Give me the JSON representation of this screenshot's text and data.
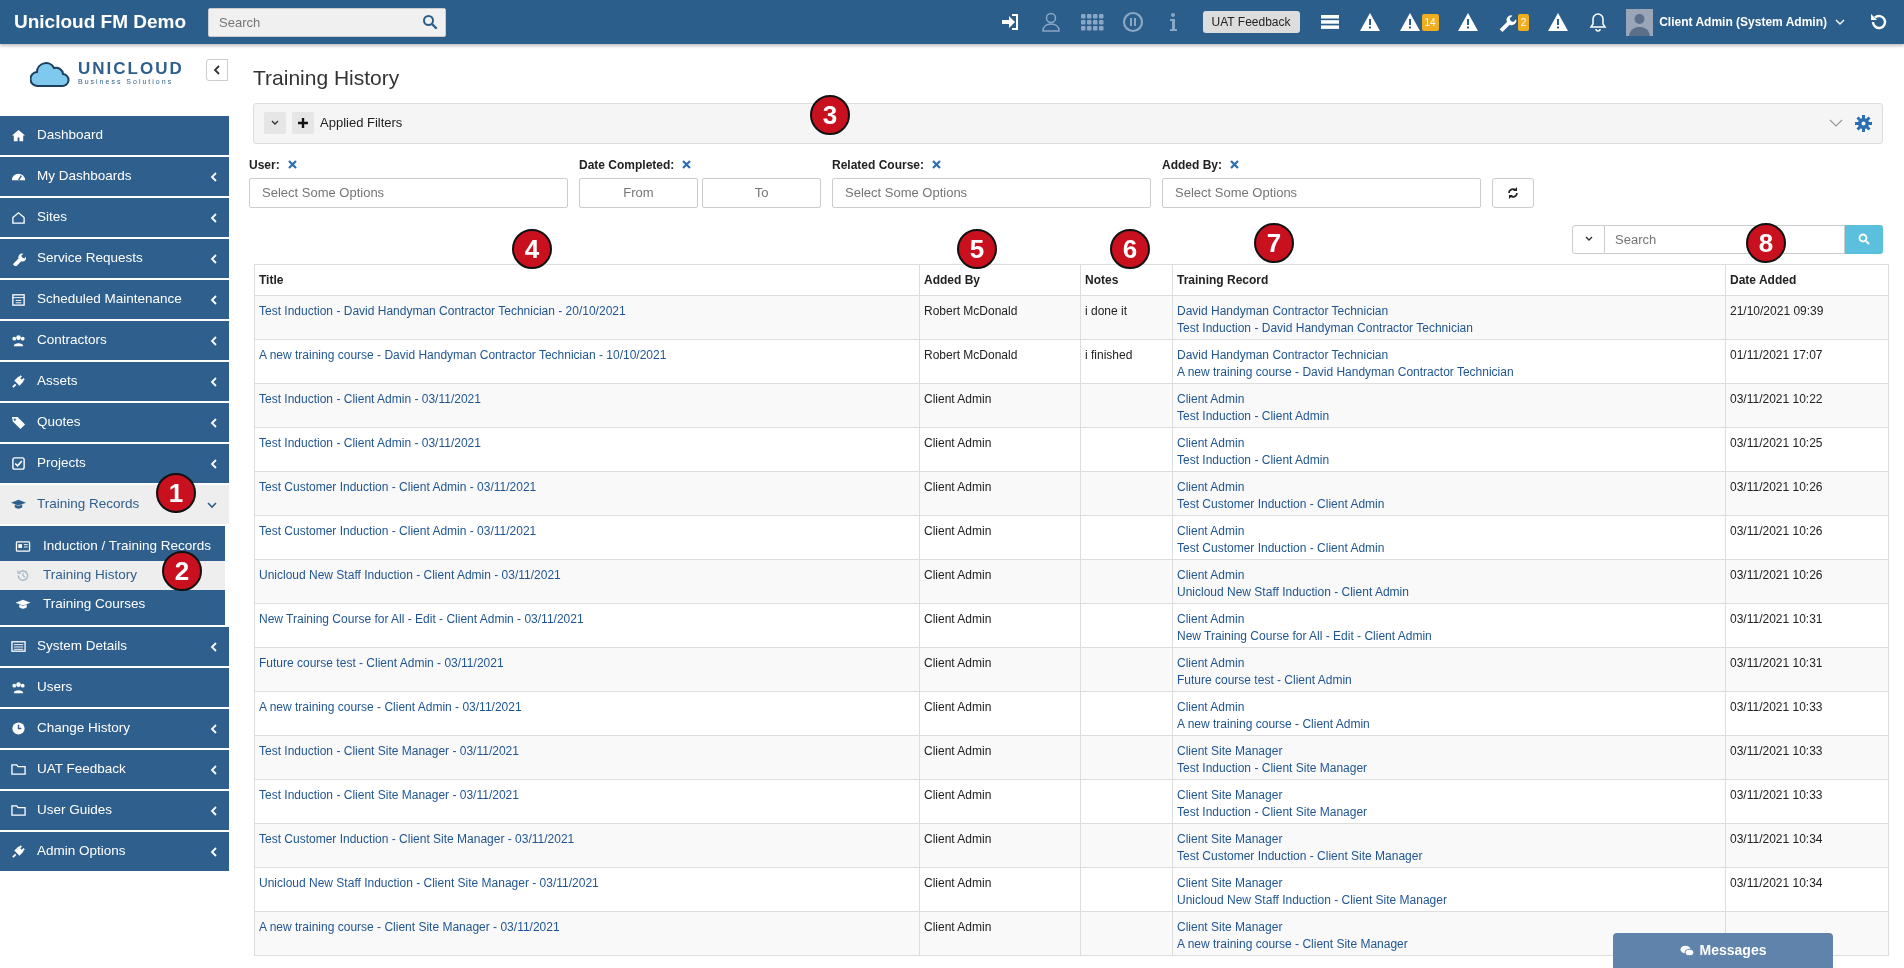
{
  "topbar": {
    "brand": "Unicloud FM Demo",
    "search": {
      "placeholder": "Search"
    },
    "feedback_button": "UAT Feedback",
    "alert_badge": "14",
    "tools_badge": "2",
    "user": "Client Admin (System Admin)"
  },
  "sidebar": {
    "logo": {
      "name": "UNICLOUD",
      "tagline": "Business Solutions"
    },
    "items": [
      {
        "label": "Dashboard",
        "kind": "link",
        "expanded": false,
        "selected": false
      },
      {
        "label": "My Dashboards",
        "kind": "menu",
        "expanded": false,
        "selected": false
      },
      {
        "label": "Sites",
        "kind": "menu",
        "expanded": false,
        "selected": false
      },
      {
        "label": "Service Requests",
        "kind": "menu",
        "expanded": false,
        "selected": false
      },
      {
        "label": "Scheduled Maintenance",
        "kind": "menu",
        "expanded": false,
        "selected": false
      },
      {
        "label": "Contractors",
        "kind": "menu",
        "expanded": false,
        "selected": false
      },
      {
        "label": "Assets",
        "kind": "menu",
        "expanded": false,
        "selected": false
      },
      {
        "label": "Quotes",
        "kind": "menu",
        "expanded": false,
        "selected": false
      },
      {
        "label": "Projects",
        "kind": "menu",
        "expanded": false,
        "selected": false
      },
      {
        "label": "Training Records",
        "kind": "menu",
        "expanded": true,
        "selected": true,
        "children": [
          {
            "label": "Induction / Training Records",
            "selected": false
          },
          {
            "label": "Training History",
            "selected": true
          },
          {
            "label": "Training Courses",
            "selected": false
          }
        ]
      },
      {
        "label": "System Details",
        "kind": "menu",
        "expanded": false,
        "selected": false
      },
      {
        "label": "Users",
        "kind": "link",
        "expanded": false,
        "selected": false
      },
      {
        "label": "Change History",
        "kind": "menu",
        "expanded": false,
        "selected": false
      },
      {
        "label": "UAT Feedback",
        "kind": "menu",
        "expanded": false,
        "selected": false
      },
      {
        "label": "User Guides",
        "kind": "menu",
        "expanded": false,
        "selected": false
      },
      {
        "label": "Admin Options",
        "kind": "menu",
        "expanded": false,
        "selected": false
      }
    ]
  },
  "page_title": "Training History",
  "filter_bar": {
    "label": "Applied Filters"
  },
  "filters": [
    {
      "label": "User:",
      "kind": "select",
      "placeholder": "Select Some Options"
    },
    {
      "label": "Date Completed:",
      "kind": "range",
      "from_placeholder": "From",
      "to_placeholder": "To"
    },
    {
      "label": "Related Course:",
      "kind": "select",
      "placeholder": "Select Some Options"
    },
    {
      "label": "Added By:",
      "kind": "select",
      "placeholder": "Select Some Options"
    }
  ],
  "table_search": {
    "placeholder": "Search"
  },
  "table": {
    "columns": [
      "Title",
      "Added By",
      "Notes",
      "Training Record",
      "Date Added"
    ],
    "rows": [
      {
        "title": "Test Induction - David Handyman Contractor Technician - 20/10/2021",
        "added_by": "Robert McDonald",
        "notes": "i done it",
        "record": [
          "David Handyman Contractor Technician",
          "Test Induction - David Handyman Contractor Technician"
        ],
        "date_added": "21/10/2021 09:39"
      },
      {
        "title": "A new training course - David Handyman Contractor Technician - 10/10/2021",
        "added_by": "Robert McDonald",
        "notes": "i finished",
        "record": [
          "David Handyman Contractor Technician",
          "A new training course - David Handyman Contractor Technician"
        ],
        "date_added": "01/11/2021 17:07"
      },
      {
        "title": "Test Induction - Client Admin - 03/11/2021",
        "added_by": "Client Admin",
        "record": [
          "Client Admin",
          "Test Induction - Client Admin"
        ],
        "date_added": "03/11/2021 10:22"
      },
      {
        "title": "Test Induction - Client Admin - 03/11/2021",
        "added_by": "Client Admin",
        "record": [
          "Client Admin",
          "Test Induction - Client Admin"
        ],
        "date_added": "03/11/2021 10:25"
      },
      {
        "title": "Test Customer Induction - Client Admin - 03/11/2021",
        "added_by": "Client Admin",
        "record": [
          "Client Admin",
          "Test Customer Induction - Client Admin"
        ],
        "date_added": "03/11/2021 10:26"
      },
      {
        "title": "Test Customer Induction - Client Admin - 03/11/2021",
        "added_by": "Client Admin",
        "record": [
          "Client Admin",
          "Test Customer Induction - Client Admin"
        ],
        "date_added": "03/11/2021 10:26"
      },
      {
        "title": "Unicloud New Staff Induction - Client Admin - 03/11/2021",
        "added_by": "Client Admin",
        "record": [
          "Client Admin",
          "Unicloud New Staff Induction - Client Admin"
        ],
        "date_added": "03/11/2021 10:26"
      },
      {
        "title": "New Training Course for All - Edit - Client Admin - 03/11/2021",
        "added_by": "Client Admin",
        "record": [
          "Client Admin",
          "New Training Course for All - Edit - Client Admin"
        ],
        "date_added": "03/11/2021 10:31"
      },
      {
        "title": "Future course test - Client Admin - 03/11/2021",
        "added_by": "Client Admin",
        "record": [
          "Client Admin",
          "Future course test - Client Admin"
        ],
        "date_added": "03/11/2021 10:31"
      },
      {
        "title": "A new training course - Client Admin - 03/11/2021",
        "added_by": "Client Admin",
        "record": [
          "Client Admin",
          "A new training course - Client Admin"
        ],
        "date_added": "03/11/2021 10:33"
      },
      {
        "title": "Test Induction - Client Site Manager - 03/11/2021",
        "added_by": "Client Admin",
        "record": [
          "Client Site Manager",
          "Test Induction - Client Site Manager"
        ],
        "date_added": "03/11/2021 10:33"
      },
      {
        "title": "Test Induction - Client Site Manager - 03/11/2021",
        "added_by": "Client Admin",
        "record": [
          "Client Site Manager",
          "Test Induction - Client Site Manager"
        ],
        "date_added": "03/11/2021 10:33"
      },
      {
        "title": "Test Customer Induction - Client Site Manager - 03/11/2021",
        "added_by": "Client Admin",
        "record": [
          "Client Site Manager",
          "Test Customer Induction - Client Site Manager"
        ],
        "date_added": "03/11/2021 10:34"
      },
      {
        "title": "Unicloud New Staff Induction - Client Site Manager - 03/11/2021",
        "added_by": "Client Admin",
        "record": [
          "Client Site Manager",
          "Unicloud New Staff Induction - Client Site Manager"
        ],
        "date_added": "03/11/2021 10:34"
      },
      {
        "title": "A new training course - Client Site Manager - 03/11/2021",
        "added_by": "Client Admin",
        "record": [
          "Client Site Manager",
          "A new training course - Client Site Manager"
        ]
      }
    ]
  },
  "messages_button": "Messages",
  "markers": [
    {
      "label": "1"
    },
    {
      "label": "2"
    },
    {
      "label": "3"
    },
    {
      "label": "4"
    },
    {
      "label": "5"
    },
    {
      "label": "6"
    },
    {
      "label": "7"
    },
    {
      "label": "8"
    }
  ]
}
